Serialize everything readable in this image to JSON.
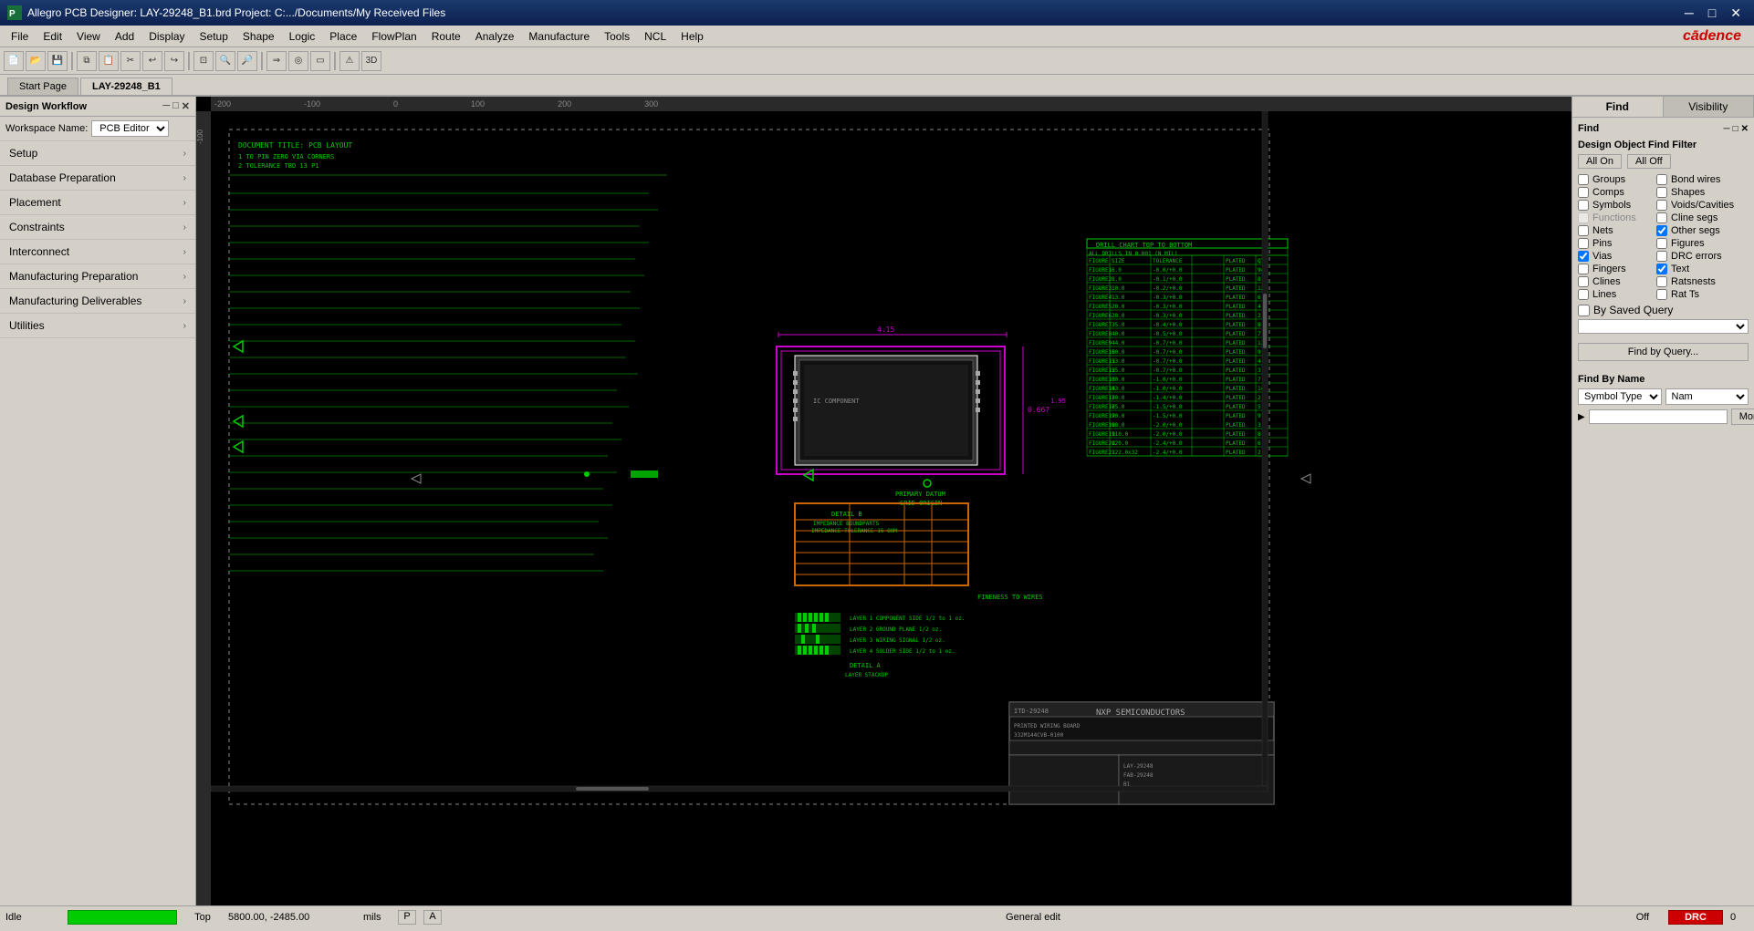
{
  "titlebar": {
    "title": "Allegro PCB Designer: LAY-29248_B1.brd  Project: C:.../Documents/My Received Files",
    "icon": "pcb-icon",
    "minimize_label": "─",
    "maximize_label": "□",
    "close_label": "✕"
  },
  "menubar": {
    "items": [
      {
        "label": "File",
        "id": "file"
      },
      {
        "label": "Edit",
        "id": "edit"
      },
      {
        "label": "View",
        "id": "view"
      },
      {
        "label": "Add",
        "id": "add"
      },
      {
        "label": "Display",
        "id": "display"
      },
      {
        "label": "Setup",
        "id": "setup"
      },
      {
        "label": "Shape",
        "id": "shape"
      },
      {
        "label": "Logic",
        "id": "logic"
      },
      {
        "label": "Place",
        "id": "place"
      },
      {
        "label": "FlowPlan",
        "id": "flowplan"
      },
      {
        "label": "Route",
        "id": "route"
      },
      {
        "label": "Analyze",
        "id": "analyze"
      },
      {
        "label": "Manufacture",
        "id": "manufacture"
      },
      {
        "label": "Tools",
        "id": "tools"
      },
      {
        "label": "NCL",
        "id": "ncl"
      },
      {
        "label": "Help",
        "id": "help"
      }
    ],
    "cadence_logo": "cādence"
  },
  "tabs": {
    "items": [
      {
        "label": "Start Page",
        "active": false
      },
      {
        "label": "LAY-29248_B1",
        "active": true
      }
    ]
  },
  "workflow": {
    "title": "Design Workflow",
    "workspace_label": "Workspace Name:",
    "workspace_value": "PCB Editor",
    "items": [
      {
        "label": "Setup",
        "id": "setup"
      },
      {
        "label": "Database Preparation",
        "id": "db-prep"
      },
      {
        "label": "Placement",
        "id": "placement"
      },
      {
        "label": "Constraints",
        "id": "constraints"
      },
      {
        "label": "Interconnect",
        "id": "interconnect"
      },
      {
        "label": "Manufacturing Preparation",
        "id": "mfg-prep"
      },
      {
        "label": "Manufacturing Deliverables",
        "id": "mfg-del"
      },
      {
        "label": "Utilities",
        "id": "utilities"
      }
    ]
  },
  "right_panel": {
    "tabs": [
      {
        "label": "Find",
        "active": true
      },
      {
        "label": "Visibility",
        "active": false
      }
    ],
    "find": {
      "title": "Find",
      "filter_title": "Design Object Find Filter",
      "all_on_label": "All On",
      "all_off_label": "All Off",
      "checkboxes": [
        {
          "label": "Groups",
          "checked": false,
          "col": 0
        },
        {
          "label": "Bond wires",
          "checked": false,
          "col": 1
        },
        {
          "label": "Comps",
          "checked": false,
          "col": 0
        },
        {
          "label": "Shapes",
          "checked": false,
          "col": 1
        },
        {
          "label": "Symbols",
          "checked": false,
          "col": 0
        },
        {
          "label": "Voids/Cavities",
          "checked": false,
          "col": 1
        },
        {
          "label": "Functions",
          "checked": false,
          "col": 0
        },
        {
          "label": "Cline segs",
          "checked": false,
          "col": 1
        },
        {
          "label": "Nets",
          "checked": false,
          "col": 0
        },
        {
          "label": "Other segs",
          "checked": true,
          "col": 1
        },
        {
          "label": "Pins",
          "checked": false,
          "col": 0
        },
        {
          "label": "Figures",
          "checked": false,
          "col": 1
        },
        {
          "label": "Vias",
          "checked": true,
          "col": 0
        },
        {
          "label": "DRC errors",
          "checked": false,
          "col": 1
        },
        {
          "label": "Fingers",
          "checked": false,
          "col": 0
        },
        {
          "label": "Text",
          "checked": true,
          "col": 1
        },
        {
          "label": "Clines",
          "checked": false,
          "col": 0
        },
        {
          "label": "Ratsnests",
          "checked": false,
          "col": 1
        },
        {
          "label": "Lines",
          "checked": false,
          "col": 0
        },
        {
          "label": "Rat Ts",
          "checked": false,
          "col": 1
        }
      ],
      "by_saved_query_label": "By Saved Query",
      "find_by_query_label": "Find by Query...",
      "find_by_name_label": "Find By Name",
      "symbol_type_label": "Symbol Type",
      "name_label": "Nam",
      "more_label": "More..."
    }
  },
  "statusbar": {
    "idle_label": "Idle",
    "layer_label": "Top",
    "coords": "5800.00, -2485.00",
    "units": "mils",
    "p_label": "P",
    "a_label": "A",
    "general_edit": "General edit",
    "off_label": "Off",
    "drc_label": "DRC",
    "drc_count": "0"
  },
  "canvas": {
    "bg_color": "#000000"
  }
}
